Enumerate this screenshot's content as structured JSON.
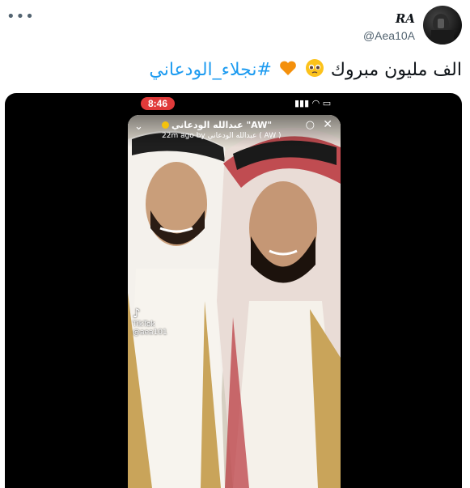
{
  "header": {
    "more_icon": "more-icon",
    "display_name": "RA",
    "handle": "@Aea10A"
  },
  "tweet": {
    "text": "الف مليون مبروك",
    "emojis": [
      "pleading-face",
      "orange-heart"
    ],
    "hashtag": "#نجلاء_الودعاني"
  },
  "media": {
    "status_time": "8:46",
    "story_title": "عبدالله الودعاني \"AW\"",
    "story_sub": "22m ago by عبدالله الودعاني ( AW )",
    "watermark_brand": "TikTok",
    "watermark_user": "@aea101"
  },
  "colors": {
    "hashtag": "#1d9bf0",
    "time_pill": "#e03a3a",
    "text": "#0f1419",
    "muted": "#536471"
  }
}
